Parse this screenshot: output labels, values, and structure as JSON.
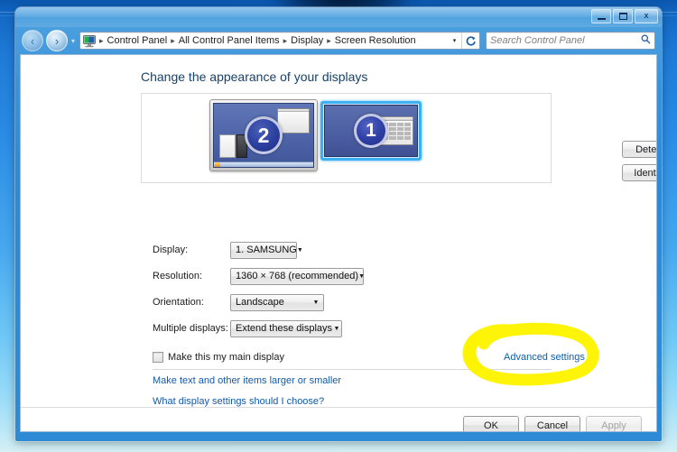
{
  "window": {
    "controls": {
      "minimize_label": "Minimize",
      "maximize_label": "Maximize",
      "close_label": "x"
    }
  },
  "navbar": {
    "back_label": "‹",
    "forward_label": "›",
    "recent_caret": "▾",
    "address_icon": "display-applet-icon",
    "breadcrumbs": [
      "Control Panel",
      "All Control Panel Items",
      "Display",
      "Screen Resolution"
    ],
    "separator": "▸",
    "dropdown_caret": "▾",
    "refresh_label": "↻",
    "search": {
      "placeholder": "Search Control Panel",
      "value": "",
      "icon": "🔍"
    }
  },
  "page": {
    "title": "Change the appearance of your displays",
    "preview": {
      "monitor_secondary": {
        "number": "2",
        "selected": false
      },
      "monitor_primary": {
        "number": "1",
        "selected": true
      }
    },
    "side_buttons": [
      {
        "label": "Detect",
        "disabled": false
      },
      {
        "label": "Identify",
        "disabled": false
      }
    ],
    "fields": [
      {
        "label": "Display:",
        "value": "1. SAMSUNG",
        "width_class": "w-display"
      },
      {
        "label": "Resolution:",
        "value": "1360 × 768 (recommended)",
        "width_class": "w-res"
      },
      {
        "label": "Orientation:",
        "value": "Landscape",
        "width_class": "w-ori"
      },
      {
        "label": "Multiple displays:",
        "value": "Extend these displays",
        "width_class": "w-multi"
      }
    ],
    "checkbox": {
      "label": "Make this my main display",
      "checked": false
    },
    "advanced_link": "Advanced settings",
    "links": [
      "Make text and other items larger or smaller",
      "What display settings should I choose?"
    ],
    "dialog_buttons": [
      {
        "label": "OK",
        "disabled": false
      },
      {
        "label": "Cancel",
        "disabled": false
      },
      {
        "label": "Apply",
        "disabled": true
      }
    ]
  },
  "annotation": {
    "type": "hand-drawn-highlight-ellipse",
    "color": "#fdf400",
    "target": "Advanced settings"
  },
  "colors": {
    "frame_blue": "#2f89d4",
    "accent_link": "#1259a8",
    "title_blue": "#17426b",
    "highlight_yellow": "#fdf400",
    "selection_glow": "#3cb0f0"
  }
}
